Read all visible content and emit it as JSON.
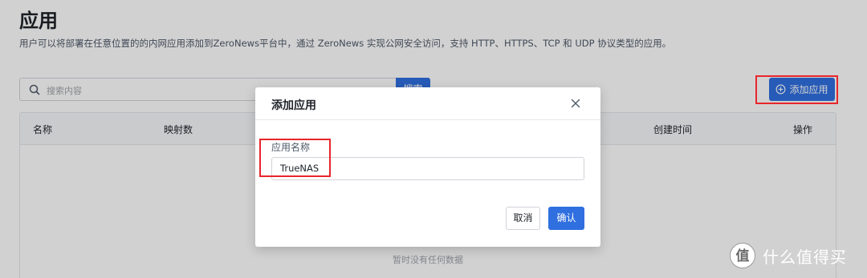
{
  "page": {
    "title": "应用",
    "description": "用户可以将部署在任意位置的的内网应用添加到ZeroNews平台中，通过 ZeroNews 实现公网安全访问，支持 HTTP、HTTPS、TCP 和 UDP 协议类型的应用。"
  },
  "toolbar": {
    "search_placeholder": "搜索内容",
    "search_button": "搜索",
    "add_app_button": "添加应用"
  },
  "table": {
    "columns": [
      "名称",
      "映射数",
      "创建时间",
      "操作"
    ],
    "empty_text": "暂时没有任何数据"
  },
  "modal": {
    "title": "添加应用",
    "field_label": "应用名称",
    "field_value": "TrueNAS",
    "cancel_label": "取消",
    "confirm_label": "确认"
  },
  "watermark": {
    "text": "什么值得买",
    "logo_glyph": "值"
  },
  "colors": {
    "primary": "#2f6fe0",
    "highlight": "#e8262b"
  }
}
